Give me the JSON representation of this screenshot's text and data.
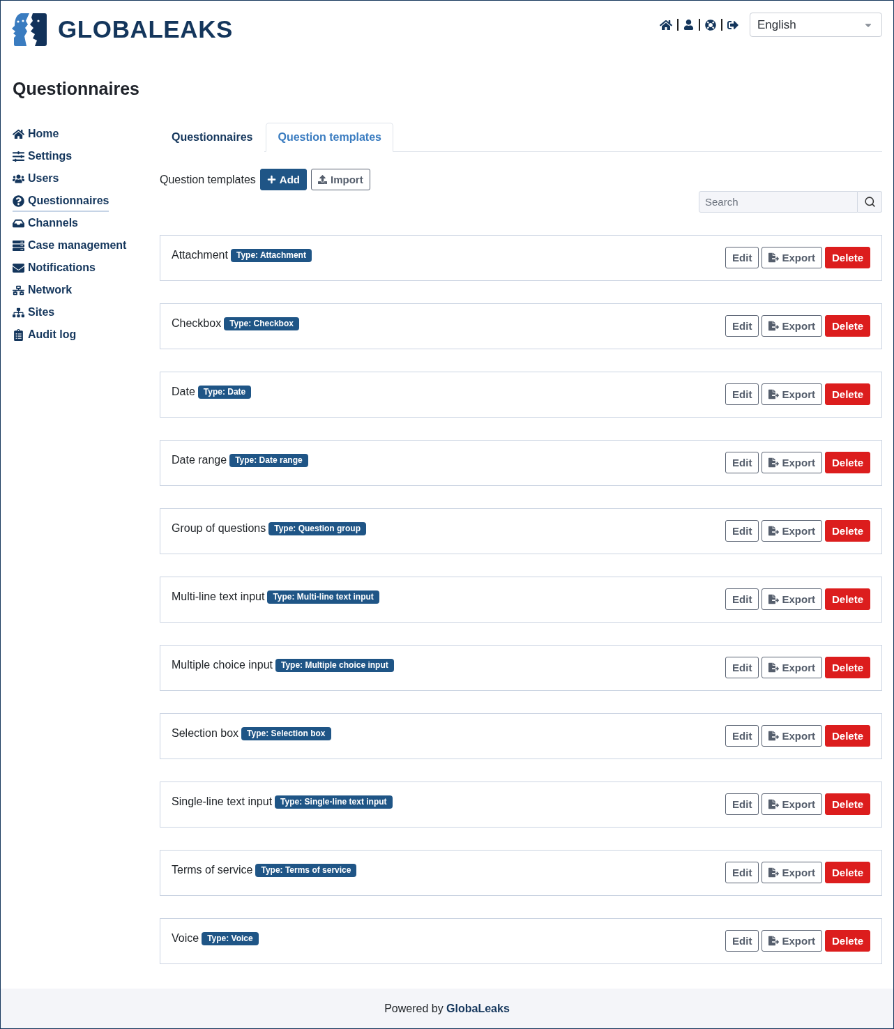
{
  "header": {
    "logo_text": "GLOBALEAKS",
    "language": "English"
  },
  "page_title": "Questionnaires",
  "sidebar": {
    "items": [
      {
        "label": "Home",
        "selected": false
      },
      {
        "label": "Settings",
        "selected": false
      },
      {
        "label": "Users",
        "selected": false
      },
      {
        "label": "Questionnaires",
        "selected": true
      },
      {
        "label": "Channels",
        "selected": false
      },
      {
        "label": "Case management",
        "selected": false
      },
      {
        "label": "Notifications",
        "selected": false
      },
      {
        "label": "Network",
        "selected": false
      },
      {
        "label": "Sites",
        "selected": false
      },
      {
        "label": "Audit log",
        "selected": false
      }
    ]
  },
  "tabs": [
    {
      "label": "Questionnaires",
      "selected": false
    },
    {
      "label": "Question templates",
      "selected": true
    }
  ],
  "toolbar": {
    "label": "Question templates",
    "buttons": [
      {
        "label": "Add",
        "kind": "add"
      },
      {
        "label": "Import",
        "kind": "import"
      }
    ]
  },
  "search": {
    "placeholder": "Search"
  },
  "templates": [
    {
      "title": "Attachment",
      "badge": "Type: Attachment",
      "actions": [
        {
          "label": "Edit",
          "kind": "plain"
        },
        {
          "label": "Export",
          "kind": "export"
        },
        {
          "label": "Delete",
          "kind": "danger"
        }
      ]
    },
    {
      "title": "Checkbox",
      "badge": "Type: Checkbox",
      "actions": [
        {
          "label": "Edit",
          "kind": "plain"
        },
        {
          "label": "Export",
          "kind": "export"
        },
        {
          "label": "Delete",
          "kind": "danger"
        }
      ]
    },
    {
      "title": "Date",
      "badge": "Type: Date",
      "actions": [
        {
          "label": "Edit",
          "kind": "plain"
        },
        {
          "label": "Export",
          "kind": "export"
        },
        {
          "label": "Delete",
          "kind": "danger"
        }
      ]
    },
    {
      "title": "Date range",
      "badge": "Type: Date range",
      "actions": [
        {
          "label": "Edit",
          "kind": "plain"
        },
        {
          "label": "Export",
          "kind": "export"
        },
        {
          "label": "Delete",
          "kind": "danger"
        }
      ]
    },
    {
      "title": "Group of questions",
      "badge": "Type: Question group",
      "actions": [
        {
          "label": "Edit",
          "kind": "plain"
        },
        {
          "label": "Export",
          "kind": "export"
        },
        {
          "label": "Delete",
          "kind": "danger"
        }
      ]
    },
    {
      "title": "Multi-line text input",
      "badge": "Type: Multi-line text input",
      "actions": [
        {
          "label": "Edit",
          "kind": "plain"
        },
        {
          "label": "Export",
          "kind": "export"
        },
        {
          "label": "Delete",
          "kind": "danger"
        }
      ]
    },
    {
      "title": "Multiple choice input",
      "badge": "Type: Multiple choice input",
      "actions": [
        {
          "label": "Edit",
          "kind": "plain"
        },
        {
          "label": "Export",
          "kind": "export"
        },
        {
          "label": "Delete",
          "kind": "danger"
        }
      ]
    },
    {
      "title": "Selection box",
      "badge": "Type: Selection box",
      "actions": [
        {
          "label": "Edit",
          "kind": "plain"
        },
        {
          "label": "Export",
          "kind": "export"
        },
        {
          "label": "Delete",
          "kind": "danger"
        }
      ]
    },
    {
      "title": "Single-line text input",
      "badge": "Type: Single-line text input",
      "actions": [
        {
          "label": "Edit",
          "kind": "plain"
        },
        {
          "label": "Export",
          "kind": "export"
        },
        {
          "label": "Delete",
          "kind": "danger"
        }
      ]
    },
    {
      "title": "Terms of service",
      "badge": "Type: Terms of service",
      "actions": [
        {
          "label": "Edit",
          "kind": "plain"
        },
        {
          "label": "Export",
          "kind": "export"
        },
        {
          "label": "Delete",
          "kind": "danger"
        }
      ]
    },
    {
      "title": "Voice",
      "badge": "Type: Voice",
      "actions": [
        {
          "label": "Edit",
          "kind": "plain"
        },
        {
          "label": "Export",
          "kind": "export"
        },
        {
          "label": "Delete",
          "kind": "danger"
        }
      ]
    }
  ],
  "footer": "Powered by **GlobaLeaks**"
}
